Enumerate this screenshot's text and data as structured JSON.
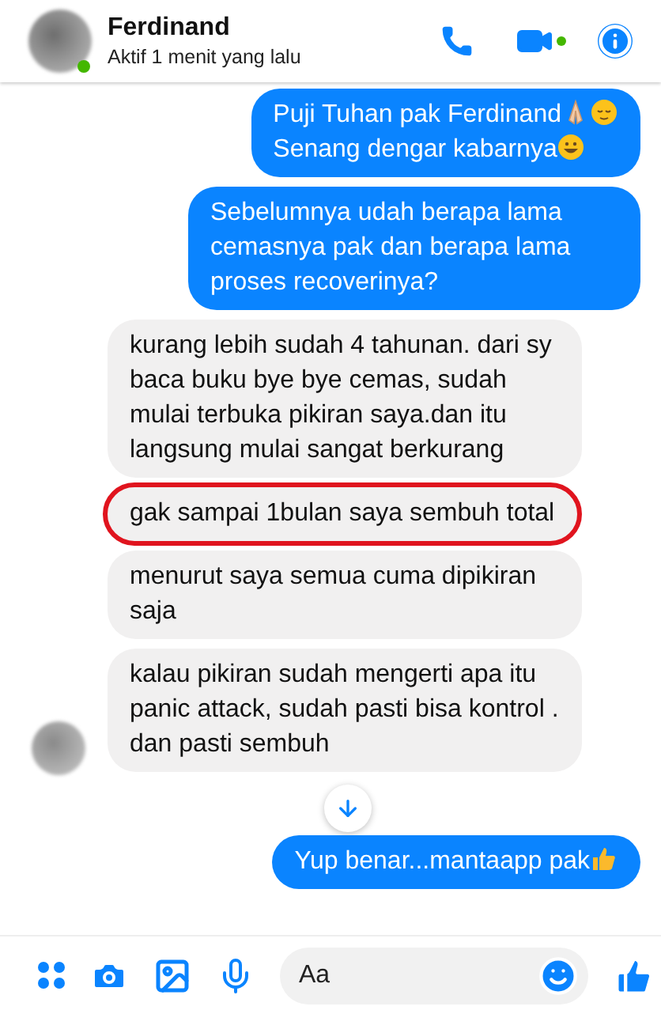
{
  "header": {
    "name": "Ferdinand",
    "status": "Aktif 1 menit yang lalu",
    "online": true
  },
  "messages": [
    {
      "kind": "sent",
      "highlighted": false,
      "lines": [
        {
          "text": "Puji Tuhan pak Ferdinand",
          "emoji": [
            {
              "kind": "pray"
            },
            {
              "kind": "relieved"
            }
          ]
        },
        {
          "text": "Senang dengar kabarnya",
          "emoji": [
            {
              "kind": "grin"
            }
          ]
        }
      ]
    },
    {
      "kind": "sent",
      "highlighted": false,
      "lines": [
        {
          "text": "Sebelumnya udah berapa lama cemasnya pak dan berapa lama proses recoverinya?"
        }
      ]
    },
    {
      "kind": "received",
      "highlighted": false,
      "lines": [
        {
          "text": "kurang lebih sudah 4 tahunan. dari sy baca buku bye bye cemas, sudah mulai terbuka pikiran saya.dan itu langsung mulai sangat berkurang"
        }
      ]
    },
    {
      "kind": "received",
      "highlighted": true,
      "lines": [
        {
          "text": "gak sampai 1bulan saya sembuh total"
        }
      ]
    },
    {
      "kind": "received",
      "highlighted": false,
      "lines": [
        {
          "text": "menurut saya semua cuma dipikiran saja"
        }
      ]
    },
    {
      "kind": "received",
      "highlighted": false,
      "avatar": true,
      "lines": [
        {
          "text": "kalau pikiran sudah mengerti apa itu panic attack, sudah pasti bisa kontrol . dan pasti sembuh"
        }
      ]
    },
    {
      "kind": "sent",
      "highlighted": false,
      "lines": [
        {
          "text": "Yup benar...mantaapp pak",
          "emoji": [
            {
              "kind": "thumbs"
            }
          ]
        }
      ]
    }
  ],
  "composer": {
    "placeholder": "Aa"
  }
}
